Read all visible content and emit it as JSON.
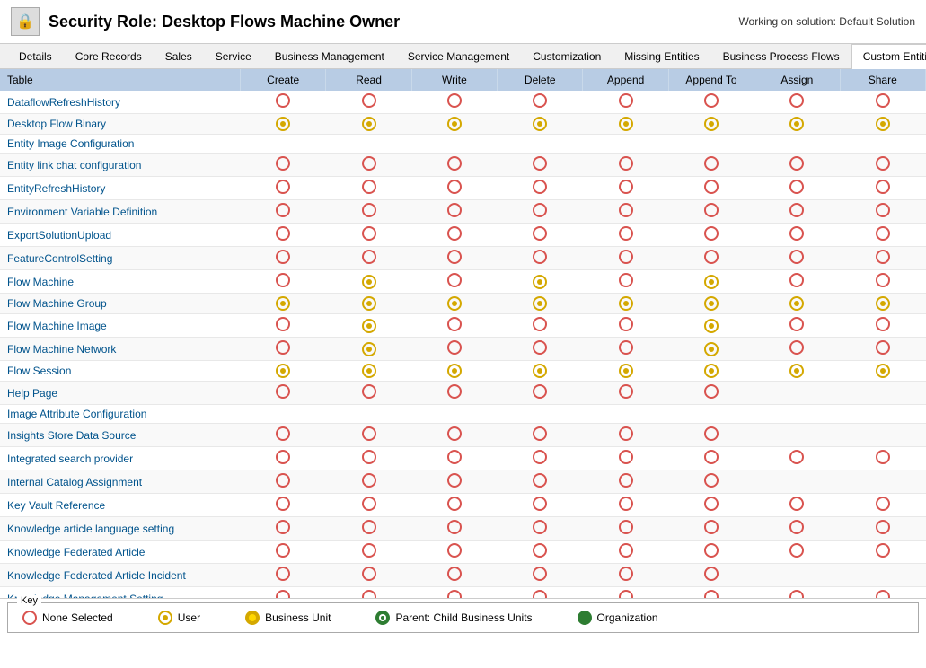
{
  "header": {
    "title": "Security Role: Desktop Flows Machine Owner",
    "working_on": "Working on solution: Default Solution",
    "icon": "🔒"
  },
  "tabs": [
    {
      "id": "details",
      "label": "Details",
      "active": false
    },
    {
      "id": "core-records",
      "label": "Core Records",
      "active": false
    },
    {
      "id": "sales",
      "label": "Sales",
      "active": false
    },
    {
      "id": "service",
      "label": "Service",
      "active": false
    },
    {
      "id": "business-management",
      "label": "Business Management",
      "active": false
    },
    {
      "id": "service-management",
      "label": "Service Management",
      "active": false
    },
    {
      "id": "customization",
      "label": "Customization",
      "active": false
    },
    {
      "id": "missing-entities",
      "label": "Missing Entities",
      "active": false
    },
    {
      "id": "business-process-flows",
      "label": "Business Process Flows",
      "active": false
    },
    {
      "id": "custom-entities",
      "label": "Custom Entities",
      "active": true
    }
  ],
  "columns": {
    "table": "Table",
    "create": "Create",
    "read": "Read",
    "write": "Write",
    "delete": "Delete",
    "append": "Append",
    "append_to": "Append To",
    "assign": "Assign",
    "share": "Share"
  },
  "rows": [
    {
      "name": "DataflowRefreshHistory",
      "create": "none",
      "read": "none",
      "write": "none",
      "delete": "none",
      "append": "none",
      "append_to": "none",
      "assign": "none",
      "share": "none"
    },
    {
      "name": "Desktop Flow Binary",
      "create": "user",
      "read": "user",
      "write": "user",
      "delete": "user",
      "append": "user",
      "append_to": "user",
      "assign": "user",
      "share": "user"
    },
    {
      "name": "Entity Image Configuration",
      "create": "",
      "read": "",
      "write": "",
      "delete": "",
      "append": "",
      "append_to": "",
      "assign": "",
      "share": ""
    },
    {
      "name": "Entity link chat configuration",
      "create": "none",
      "read": "none",
      "write": "none",
      "delete": "none",
      "append": "none",
      "append_to": "none",
      "assign": "none",
      "share": "none"
    },
    {
      "name": "EntityRefreshHistory",
      "create": "none",
      "read": "none",
      "write": "none",
      "delete": "none",
      "append": "none",
      "append_to": "none",
      "assign": "none",
      "share": "none"
    },
    {
      "name": "Environment Variable Definition",
      "create": "none",
      "read": "none",
      "write": "none",
      "delete": "none",
      "append": "none",
      "append_to": "none",
      "assign": "none",
      "share": "none"
    },
    {
      "name": "ExportSolutionUpload",
      "create": "none",
      "read": "none",
      "write": "none",
      "delete": "none",
      "append": "none",
      "append_to": "none",
      "assign": "none",
      "share": "none"
    },
    {
      "name": "FeatureControlSetting",
      "create": "none",
      "read": "none",
      "write": "none",
      "delete": "none",
      "append": "none",
      "append_to": "none",
      "assign": "none",
      "share": "none"
    },
    {
      "name": "Flow Machine",
      "create": "none",
      "read": "user",
      "write": "none",
      "delete": "user",
      "append": "none",
      "append_to": "user",
      "assign": "none",
      "share": "none"
    },
    {
      "name": "Flow Machine Group",
      "create": "user",
      "read": "user",
      "write": "user",
      "delete": "user",
      "append": "user",
      "append_to": "user",
      "assign": "user",
      "share": "user"
    },
    {
      "name": "Flow Machine Image",
      "create": "none",
      "read": "user",
      "write": "none",
      "delete": "none",
      "append": "none",
      "append_to": "user",
      "assign": "none",
      "share": "none"
    },
    {
      "name": "Flow Machine Network",
      "create": "none",
      "read": "user",
      "write": "none",
      "delete": "none",
      "append": "none",
      "append_to": "user",
      "assign": "none",
      "share": "none"
    },
    {
      "name": "Flow Session",
      "create": "user",
      "read": "user",
      "write": "user",
      "delete": "user",
      "append": "user",
      "append_to": "user",
      "assign": "user",
      "share": "user"
    },
    {
      "name": "Help Page",
      "create": "none",
      "read": "none",
      "write": "none",
      "delete": "none",
      "append": "none",
      "append_to": "none",
      "assign": "",
      "share": ""
    },
    {
      "name": "Image Attribute Configuration",
      "create": "",
      "read": "",
      "write": "",
      "delete": "",
      "append": "",
      "append_to": "",
      "assign": "",
      "share": ""
    },
    {
      "name": "Insights Store Data Source",
      "create": "none",
      "read": "none",
      "write": "none",
      "delete": "none",
      "append": "none",
      "append_to": "none",
      "assign": "",
      "share": ""
    },
    {
      "name": "Integrated search provider",
      "create": "none",
      "read": "none",
      "write": "none",
      "delete": "none",
      "append": "none",
      "append_to": "none",
      "assign": "none",
      "share": "none"
    },
    {
      "name": "Internal Catalog Assignment",
      "create": "none",
      "read": "none",
      "write": "none",
      "delete": "none",
      "append": "none",
      "append_to": "none",
      "assign": "",
      "share": ""
    },
    {
      "name": "Key Vault Reference",
      "create": "none",
      "read": "none",
      "write": "none",
      "delete": "none",
      "append": "none",
      "append_to": "none",
      "assign": "none",
      "share": "none"
    },
    {
      "name": "Knowledge article language setting",
      "create": "none",
      "read": "none",
      "write": "none",
      "delete": "none",
      "append": "none",
      "append_to": "none",
      "assign": "none",
      "share": "none"
    },
    {
      "name": "Knowledge Federated Article",
      "create": "none",
      "read": "none",
      "write": "none",
      "delete": "none",
      "append": "none",
      "append_to": "none",
      "assign": "none",
      "share": "none"
    },
    {
      "name": "Knowledge Federated Article Incident",
      "create": "none",
      "read": "none",
      "write": "none",
      "delete": "none",
      "append": "none",
      "append_to": "none",
      "assign": "",
      "share": ""
    },
    {
      "name": "Knowledge Management Setting",
      "create": "none",
      "read": "none",
      "write": "none",
      "delete": "none",
      "append": "none",
      "append_to": "none",
      "assign": "none",
      "share": "none"
    }
  ],
  "key": {
    "title": "Key",
    "items": [
      {
        "id": "none",
        "type": "none",
        "label": "None Selected"
      },
      {
        "id": "user",
        "type": "user",
        "label": "User"
      },
      {
        "id": "bu",
        "type": "bu",
        "label": "Business Unit"
      },
      {
        "id": "parent-child",
        "type": "parent-child",
        "label": "Parent: Child Business Units"
      },
      {
        "id": "org",
        "type": "org",
        "label": "Organization"
      }
    ]
  }
}
